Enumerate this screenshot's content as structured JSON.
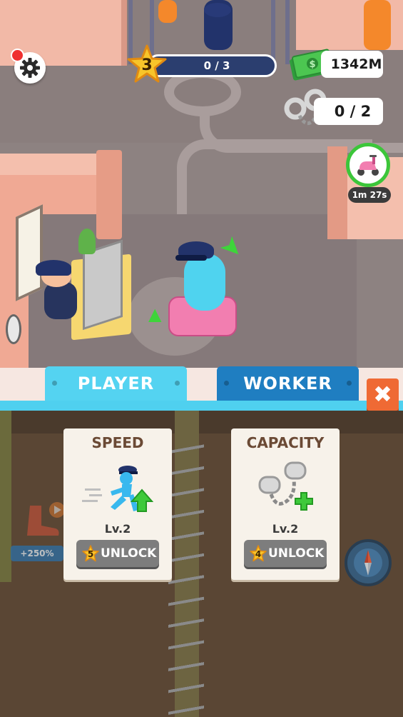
{
  "hud": {
    "level_number": "3",
    "level_progress": "0 / 3",
    "cash": "1342M",
    "handcuffs": "0 / 2",
    "timer": "1m 27s",
    "settings_has_notification": true
  },
  "tabs": [
    {
      "label": "PLAYER",
      "active": true
    },
    {
      "label": "WORKER",
      "active": false
    }
  ],
  "close_label": "✖",
  "cards": [
    {
      "title": "SPEED",
      "icon": "running-police-officer-icon",
      "level": "Lv.2",
      "cost": "5",
      "button_label": "UNLOCK"
    },
    {
      "title": "CAPACITY",
      "icon": "handcuffs-plus-icon",
      "level": "Lv.2",
      "cost": "4",
      "button_label": "UNLOCK"
    }
  ],
  "side": {
    "boost_label": "+250%",
    "boost_icon": "speed-boot-icon",
    "compass_icon": "compass-icon"
  },
  "colors": {
    "tab_active": "#54d3f1",
    "tab_inactive": "#1f7ec1",
    "close_button": "#ef6a34",
    "unlock_button": "#7d7d7d",
    "level_bar": "#2b3e6f",
    "timer_ring": "#3cc63a"
  }
}
